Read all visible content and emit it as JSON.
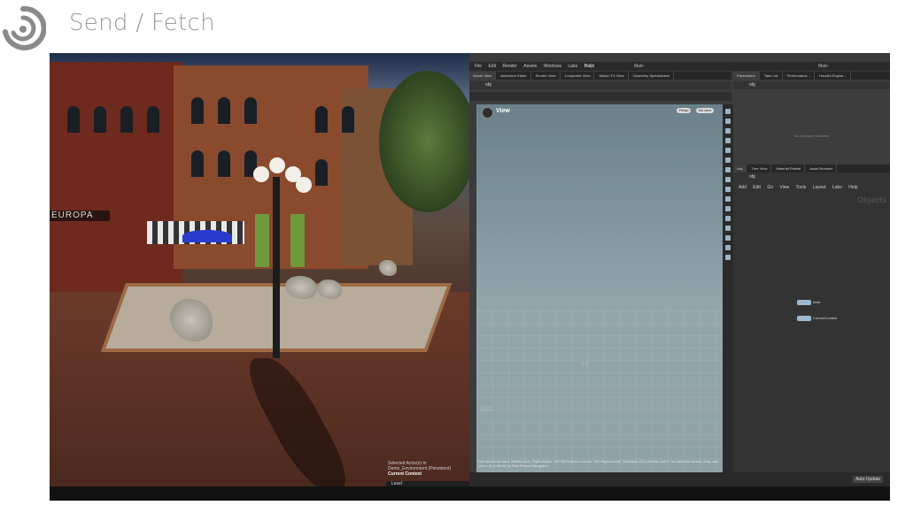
{
  "header": {
    "title": "Send / Fetch",
    "logo_icon": "spiral-logo-icon"
  },
  "unreal": {
    "storefront_sign": "EUROPA",
    "caption_line1": "Selected Actor(s) in",
    "caption_line2": "Demo_Environment (Persistent)",
    "current_context": "Current Context",
    "level_label": "Level"
  },
  "houdini": {
    "menu": [
      "File",
      "Edit",
      "Render",
      "Assets",
      "Windows",
      "Labs",
      "Help"
    ],
    "build_label": "Build",
    "main_label": "Main",
    "main_label_right": "Main",
    "viewer_tabs": [
      "Scene View",
      "Animation Editor",
      "Render View",
      "Composite View",
      "Motion FX View",
      "Geometry Spreadsheet"
    ],
    "param_tabs": [
      "Parameters",
      "Take List",
      "Performance...",
      "Houdini Engine..."
    ],
    "network_tabs": [
      "/obj",
      "Tree View",
      "Material Palette",
      "Asset Browser"
    ],
    "path": "obj",
    "viewport_title": "View",
    "persp_label": "Persp",
    "cam_label": "No cam",
    "grid_label_1": "100",
    "grid_label_2": "75",
    "status_text": "Left mouse tumbles. Middle pans. Right dollies. Ctrl+Alt+Left box-zooms. Ctrl+Right zooms. Spacebar-Ctrl-Left tilts. Hold L for alternate tumble, dolly, and zoom. M or Alt+M for First Person Navigation.",
    "no_operator": "No Operator Selected",
    "network_menu": [
      "Add",
      "Edit",
      "Go",
      "View",
      "Tools",
      "Layout",
      "Labs",
      "Help"
    ],
    "objects_label": "Objects",
    "nodes": [
      {
        "label": "level"
      },
      {
        "label": "CurrentContent"
      }
    ],
    "auto_update": "Auto Update"
  }
}
